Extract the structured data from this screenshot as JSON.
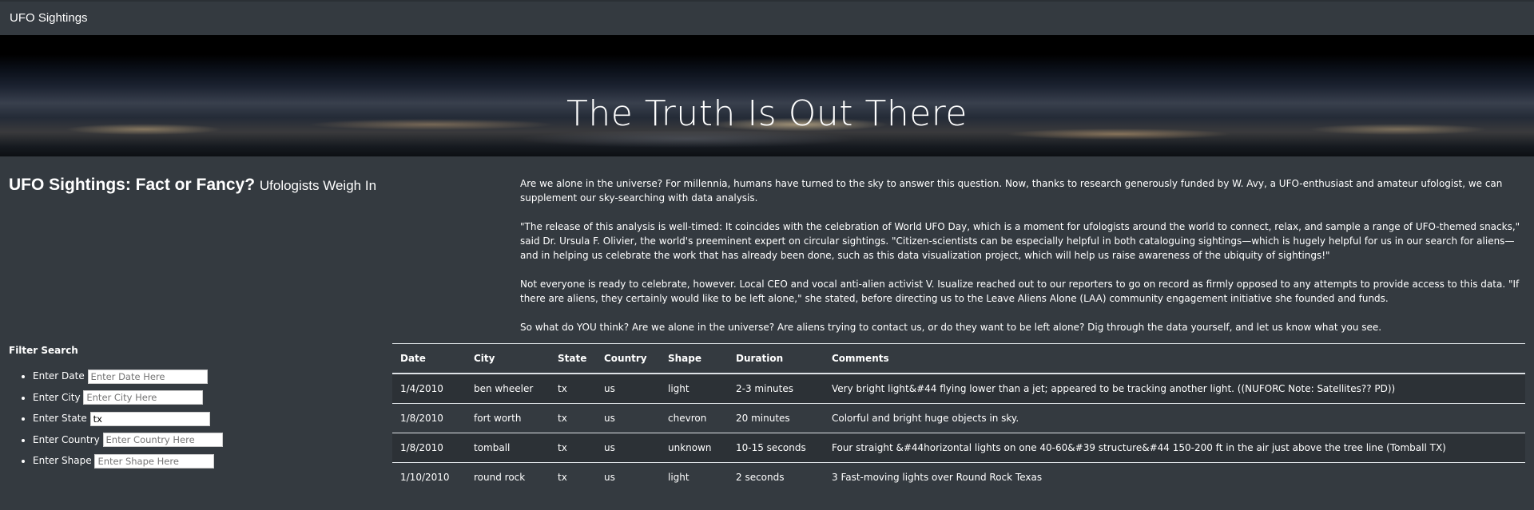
{
  "navbar": {
    "brand": "UFO Sightings"
  },
  "hero": {
    "title": "The Truth Is Out There"
  },
  "article": {
    "headline": "UFO Sightings: Fact or Fancy?",
    "subheadline": "Ufologists Weigh In",
    "paragraphs": [
      "Are we alone in the universe? For millennia, humans have turned to the sky to answer this question. Now, thanks to research generously funded by W. Avy, a UFO-enthusiast and amateur ufologist, we can supplement our sky-searching with data analysis.",
      "\"The release of this analysis is well-timed: It coincides with the celebration of World UFO Day, which is a moment for ufologists around the world to connect, relax, and sample a range of UFO-themed snacks,\" said Dr. Ursula F. Olivier, the world's preeminent expert on circular sightings. \"Citizen-scientists can be especially helpful in both cataloguing sightings—which is hugely helpful for us in our search for aliens—and in helping us celebrate the work that has already been done, such as this data visualization project, which will help us raise awareness of the ubiquity of sightings!\"",
      "Not everyone is ready to celebrate, however. Local CEO and vocal anti-alien activist V. Isualize reached out to our reporters to go on record as firmly opposed to any attempts to provide access to this data. \"If there are aliens, they certainly would like to be left alone,\" she stated, before directing us to the Leave Aliens Alone (LAA) community engagement initiative she founded and funds.",
      "So what do YOU think? Are we alone in the universe? Are aliens trying to contact us, or do they want to be left alone? Dig through the data yourself, and let us know what you see."
    ]
  },
  "filters": {
    "title": "Filter Search",
    "items": [
      {
        "label": "Enter Date",
        "placeholder": "Enter Date Here",
        "value": ""
      },
      {
        "label": "Enter City",
        "placeholder": "Enter City Here",
        "value": ""
      },
      {
        "label": "Enter State",
        "placeholder": "",
        "value": "tx"
      },
      {
        "label": "Enter Country",
        "placeholder": "Enter Country Here",
        "value": ""
      },
      {
        "label": "Enter Shape",
        "placeholder": "Enter Shape Here",
        "value": ""
      }
    ]
  },
  "table": {
    "headers": [
      "Date",
      "City",
      "State",
      "Country",
      "Shape",
      "Duration",
      "Comments"
    ],
    "rows": [
      [
        "1/4/2010",
        "ben wheeler",
        "tx",
        "us",
        "light",
        "2-3 minutes",
        "Very bright light&#44 flying lower than a jet; appeared to be tracking another light. ((NUFORC Note: Satellites?? PD))"
      ],
      [
        "1/8/2010",
        "fort worth",
        "tx",
        "us",
        "chevron",
        "20 minutes",
        "Colorful and bright huge objects in sky."
      ],
      [
        "1/8/2010",
        "tomball",
        "tx",
        "us",
        "unknown",
        "10-15 seconds",
        "Four straight &#44horizontal lights on one 40-60&#39 structure&#44 150-200 ft in the air just above the tree line (Tomball TX)"
      ],
      [
        "1/10/2010",
        "round rock",
        "tx",
        "us",
        "light",
        "2 seconds",
        "3 Fast-moving lights over Round Rock Texas"
      ]
    ]
  }
}
